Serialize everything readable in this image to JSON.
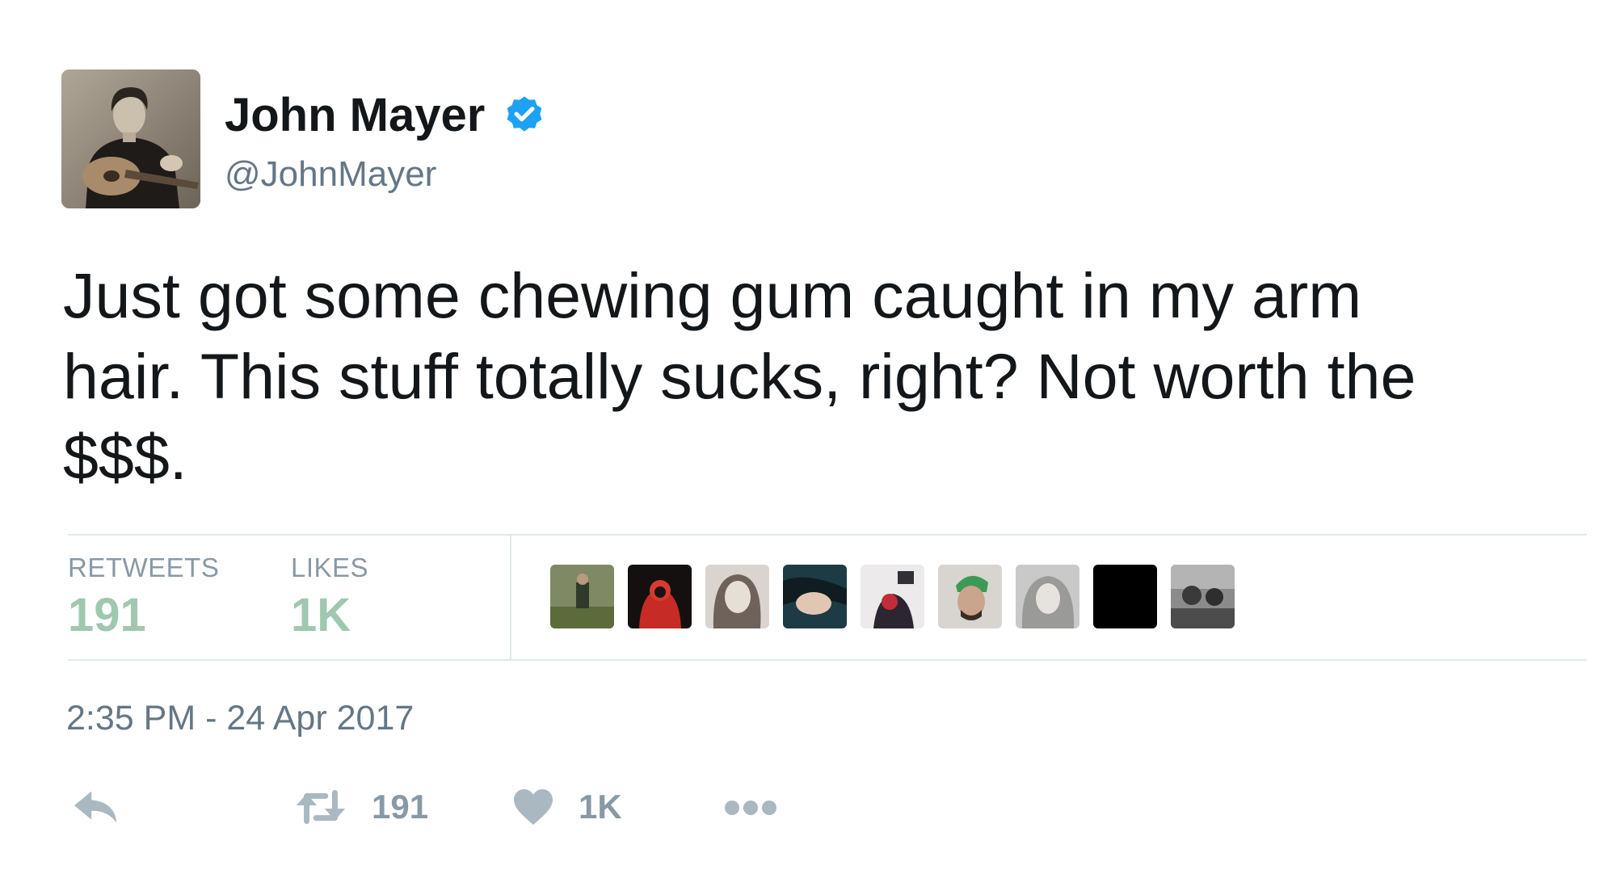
{
  "author": {
    "display_name": "John Mayer",
    "handle": "@JohnMayer",
    "verified": true,
    "verified_icon": "verified-badge-icon",
    "verified_color": "#1da1f2"
  },
  "tweet": {
    "lines": [
      "Just got some chewing gum caught in my arm",
      "hair. This stuff totally sucks, right? Not worth the",
      "$$$."
    ]
  },
  "stats": {
    "retweets_label": "RETWEETS",
    "retweets_value": "191",
    "likes_label": "LIKES",
    "likes_value": "1K",
    "value_color": "#a0c7b0",
    "liker_avatar_count": 9
  },
  "timestamp": "2:35 PM - 24 Apr 2017",
  "actions": {
    "reply_icon": "reply-icon",
    "retweet_icon": "retweet-icon",
    "retweet_count": "191",
    "like_icon": "heart-icon",
    "like_count": "1K",
    "more_icon": "more-dots-icon",
    "icon_color": "#aab8c2"
  }
}
